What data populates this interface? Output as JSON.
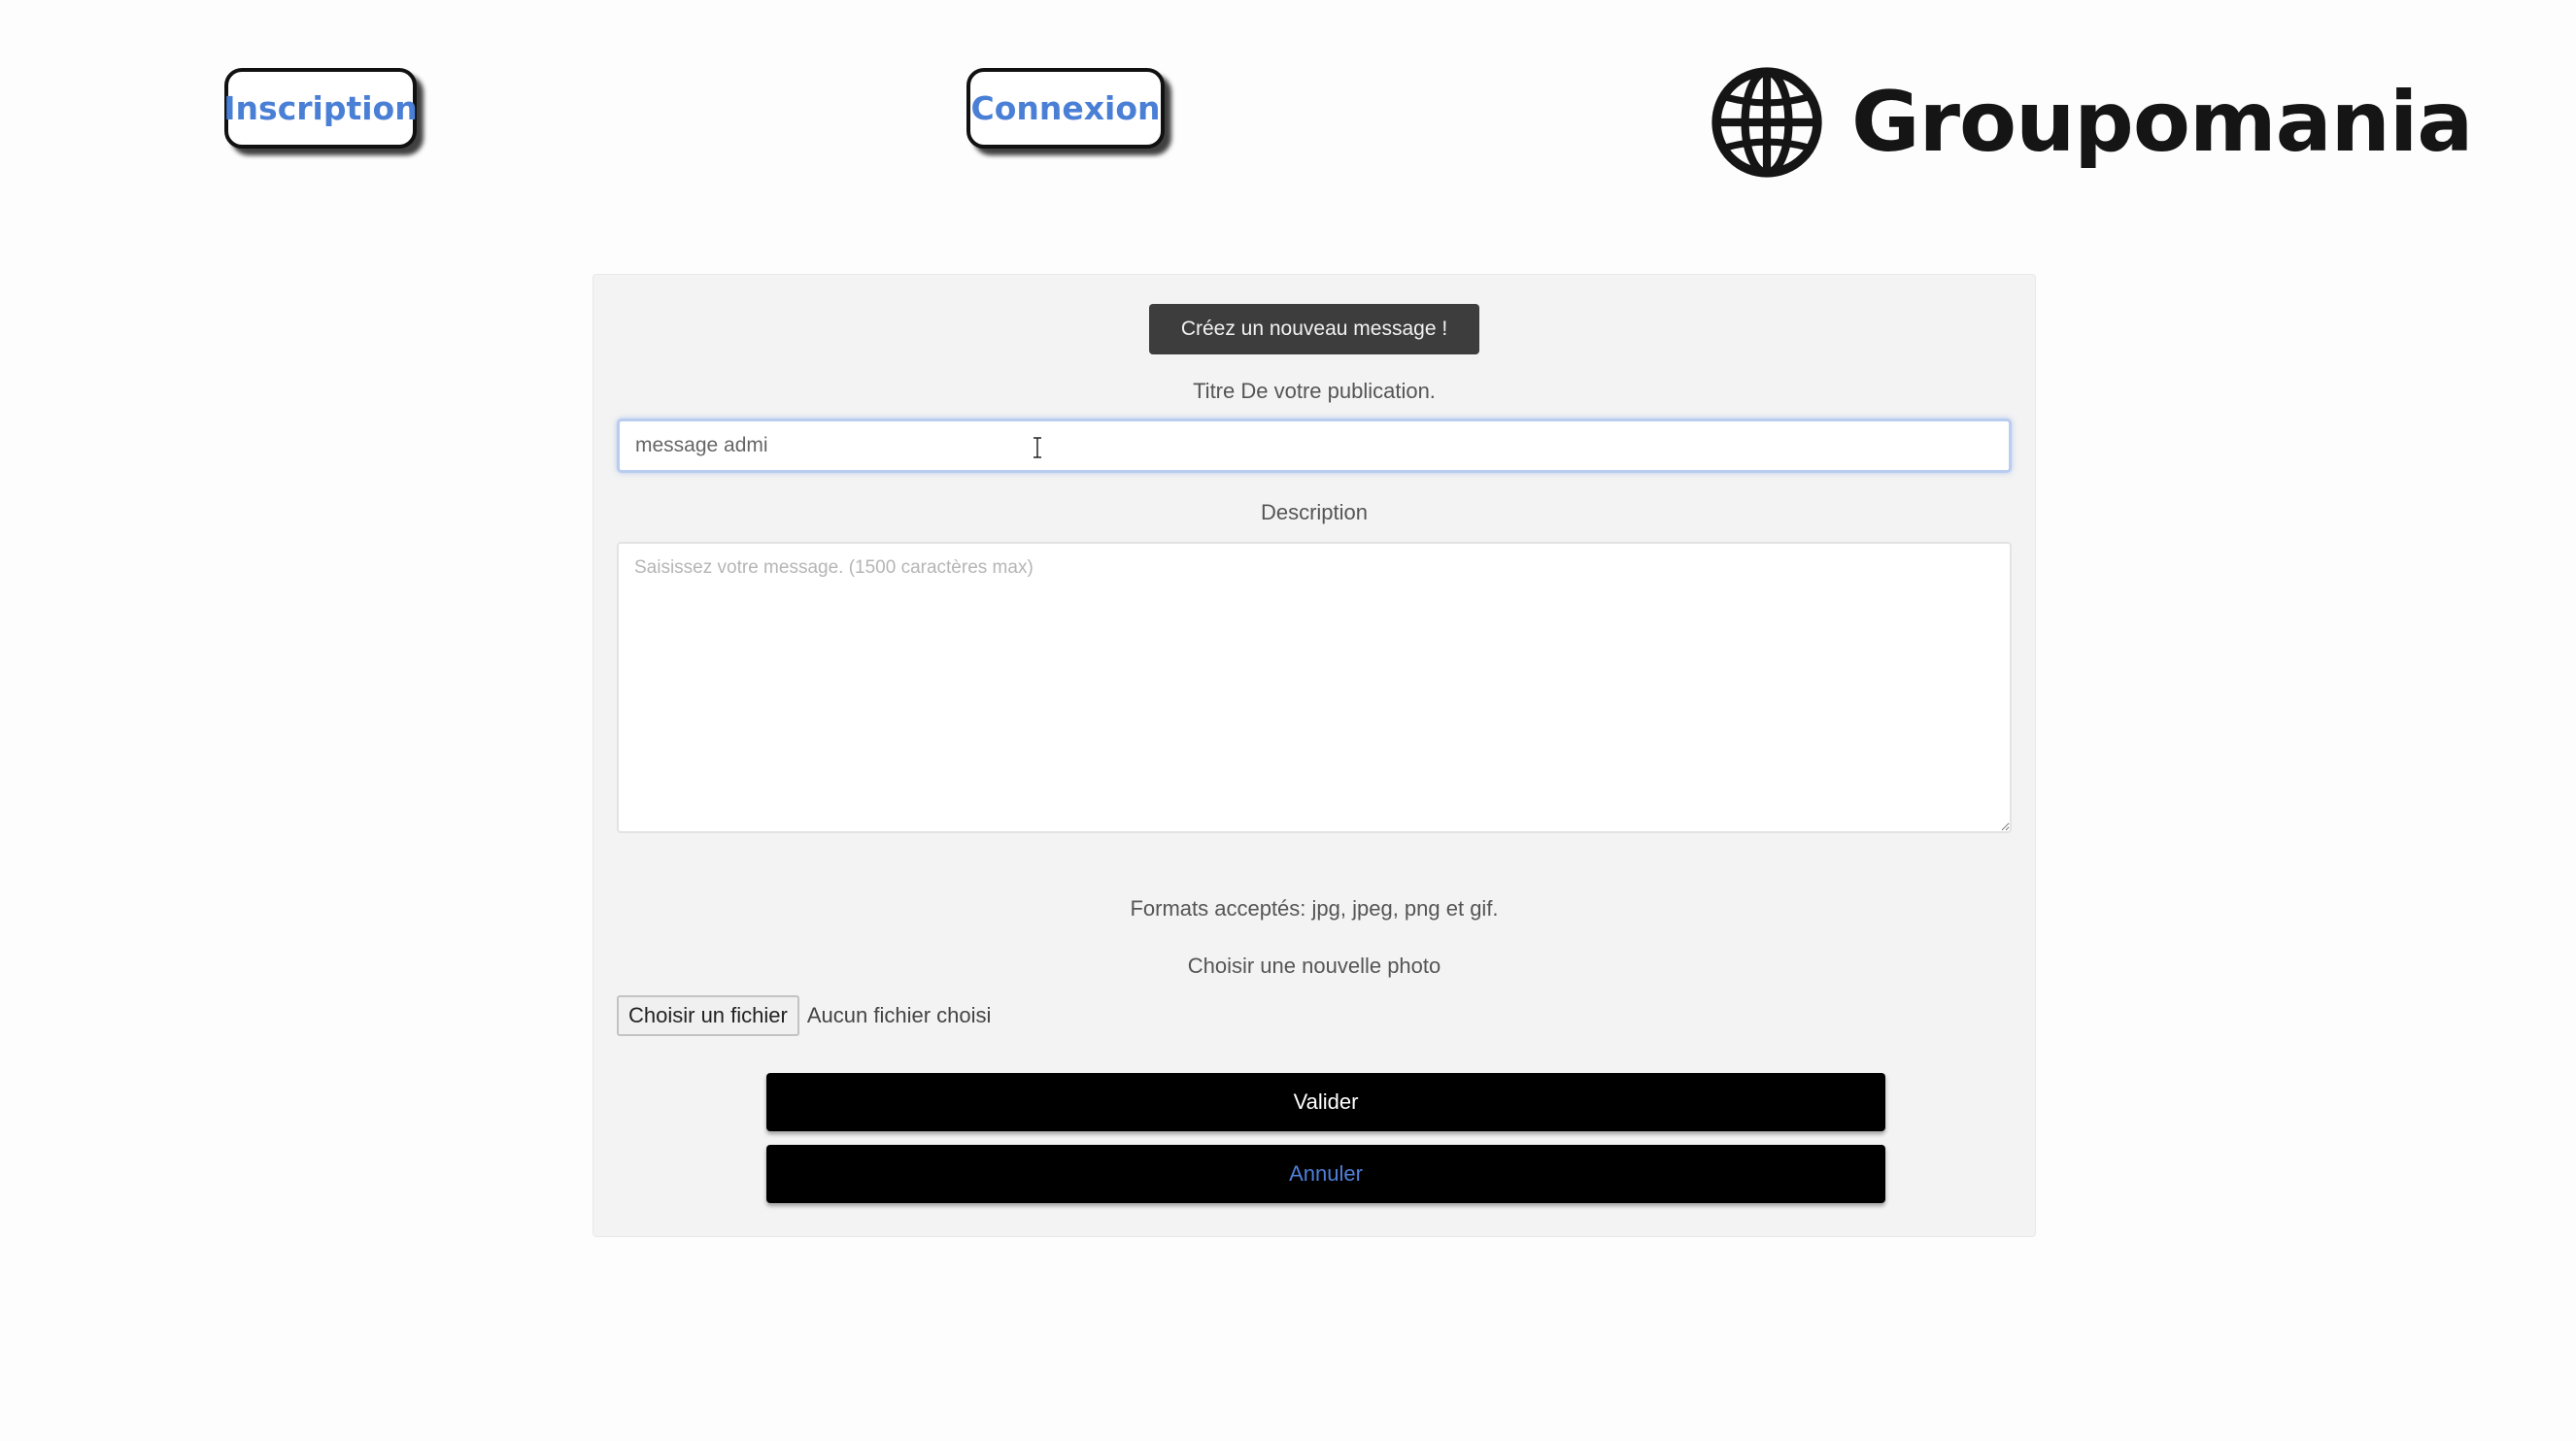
{
  "nav": {
    "inscription_label": "Inscription",
    "connexion_label": "Connexion"
  },
  "logo": {
    "text": "Groupomania",
    "icon": "globe-icon"
  },
  "form": {
    "header_badge": "Créez un nouveau message !",
    "title_label": "Titre De votre publication.",
    "title_value": "message admi",
    "description_label": "Description",
    "description_placeholder": "Saisissez votre message. (1500 caractères max)",
    "formats_label": "Formats acceptés: jpg, jpeg, png et gif.",
    "photo_label": "Choisir une nouvelle photo",
    "file_button_label": "Choisir un fichier",
    "file_status": "Aucun fichier choisi",
    "submit_label": "Valider",
    "cancel_label": "Annuler"
  },
  "colors": {
    "link_blue": "#4a7fd6",
    "badge_bg": "#3d3d3d",
    "button_bg": "#000000",
    "card_bg": "#f3f3f3"
  }
}
